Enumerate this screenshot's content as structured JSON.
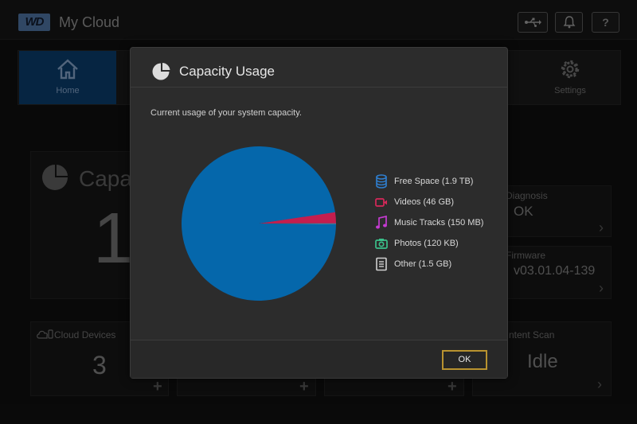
{
  "header": {
    "logo_text": "WD",
    "app_name": "My Cloud",
    "usb_icon": "usb-icon",
    "bell_icon": "bell-icon",
    "help_label": "?"
  },
  "nav": {
    "items": [
      {
        "label": "Home",
        "icon": "home-icon",
        "active": true
      },
      {
        "label": "Settings",
        "icon": "gear-icon",
        "active": false
      }
    ]
  },
  "dashboard": {
    "capacity": {
      "title": "Capa",
      "value": "1"
    },
    "diagnosis": {
      "title": "Diagnosis",
      "value": "OK"
    },
    "firmware": {
      "title": "Firmware",
      "value": "v03.01.04-139"
    },
    "cloud_devices": {
      "title": "Cloud Devices",
      "value": "3"
    },
    "content_scan": {
      "title": "ntent Scan",
      "value": "Idle"
    },
    "plus": "+",
    "chevron": "›"
  },
  "modal": {
    "title": "Capacity Usage",
    "description": "Current usage of your system capacity.",
    "ok_label": "OK",
    "legend": [
      {
        "label": "Free Space (1.9 TB)",
        "icon": "database-icon",
        "color": "#2f7fd0"
      },
      {
        "label": "Videos (46 GB)",
        "icon": "video-icon",
        "color": "#d8285a"
      },
      {
        "label": "Music Tracks (150 MB)",
        "icon": "music-icon",
        "color": "#c43ad1"
      },
      {
        "label": "Photos (120 KB)",
        "icon": "camera-icon",
        "color": "#3ac08a"
      },
      {
        "label": "Other (1.5 GB)",
        "icon": "document-icon",
        "color": "#d0d0d0"
      }
    ]
  },
  "chart_data": {
    "type": "pie",
    "labels": [
      "Free Space",
      "Videos",
      "Music Tracks",
      "Photos",
      "Other"
    ],
    "values": [
      1900,
      46,
      0.15,
      0.00012,
      1.5
    ],
    "colors": [
      "#0567ab",
      "#c41e4e",
      "#a32fb0",
      "#2fa97a",
      "#bdbdbd"
    ]
  }
}
